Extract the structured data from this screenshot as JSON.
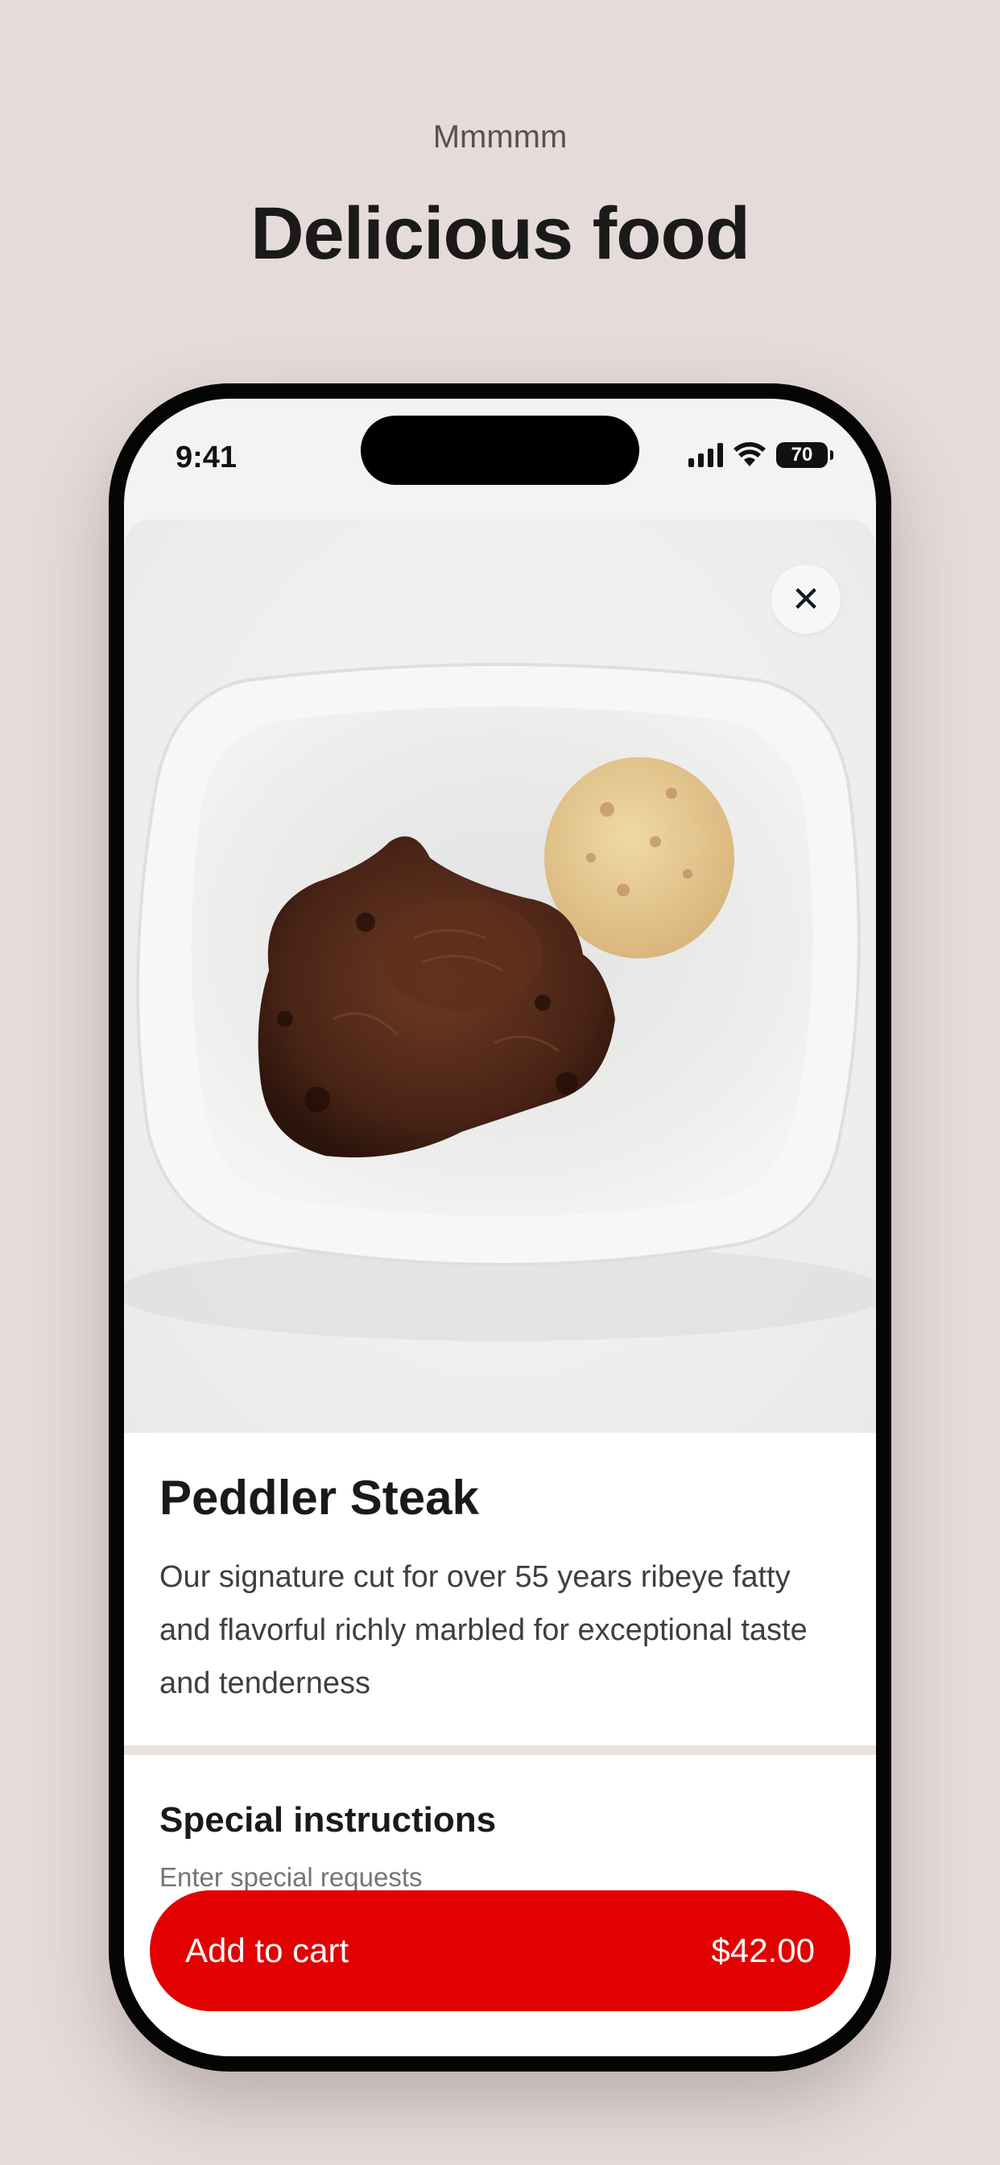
{
  "promo": {
    "eyebrow": "Mmmmm",
    "title": "Delicious food"
  },
  "status_bar": {
    "time": "9:41",
    "battery": "70"
  },
  "item": {
    "name": "Peddler Steak",
    "description": "Our signature cut for over 55 years ribeye fatty and flavorful richly marbled for exceptional taste and tenderness",
    "photo_icon": "steak-plate-photo"
  },
  "instructions": {
    "title": "Special instructions",
    "placeholder": "Enter special requests"
  },
  "cart_button": {
    "label": "Add to cart",
    "price": "$42.00"
  },
  "colors": {
    "accent": "#e30000",
    "background": "#e5dcda"
  }
}
